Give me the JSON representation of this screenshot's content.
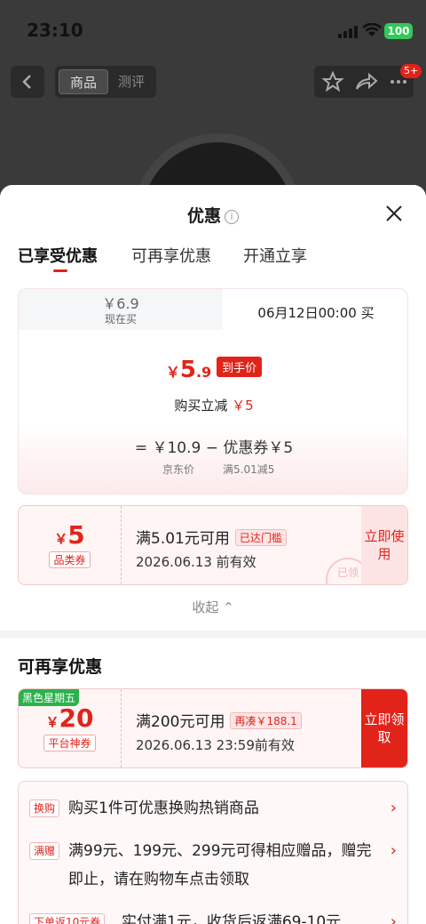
{
  "status": {
    "time": "23:10",
    "battery": "100"
  },
  "background_nav": {
    "tabs": [
      "商品",
      "测评"
    ],
    "badge": "5+"
  },
  "sheet": {
    "title": "优惠",
    "info_icon": "i",
    "tabs": [
      "已享受优惠",
      "可再享优惠",
      "开通立享"
    ],
    "price_card": {
      "now_price": "￥6.9",
      "now_label": "现在买",
      "future_label": "06月12日00:00 买",
      "final_price_symbol": "￥",
      "final_price_int": "5",
      "final_price_dec": ".9",
      "final_price_tag": "到手价",
      "cut_label": "购买立减",
      "cut_value": "￥5",
      "formula": "=  ￥10.9  −  优惠券￥5",
      "formula_sub1": "京东价",
      "formula_sub2": "满5.01减5"
    },
    "coupon1": {
      "symbol": "￥",
      "amount": "5",
      "type": "品类券",
      "title": "满5.01元可用",
      "pill": "已达门槛",
      "date": "2026.06.13 前有效",
      "action": "立即使用",
      "stamp": "已领"
    },
    "collapse_label": "收起"
  },
  "section2": {
    "title": "可再享优惠",
    "coupon": {
      "corner_tag": "黑色星期五",
      "symbol": "￥",
      "amount": "20",
      "type": "平台神券",
      "title": "满200元可用",
      "pill": "再凑￥188.1",
      "date": "2026.06.13 23:59前有效",
      "action": "立即领取"
    },
    "promos": [
      {
        "tag": "换购",
        "text": "购买1件可优惠换购热销商品"
      },
      {
        "tag": "满赠",
        "text": "满99元、199元、299元可得相应赠品，赠完即止，请在购物车点击领取"
      },
      {
        "tag": "下单返10元券",
        "text": "实付满1元，收货后返满69-10元"
      }
    ]
  },
  "colors": {
    "accent": "#e2231a",
    "green": "#2bb24c"
  }
}
